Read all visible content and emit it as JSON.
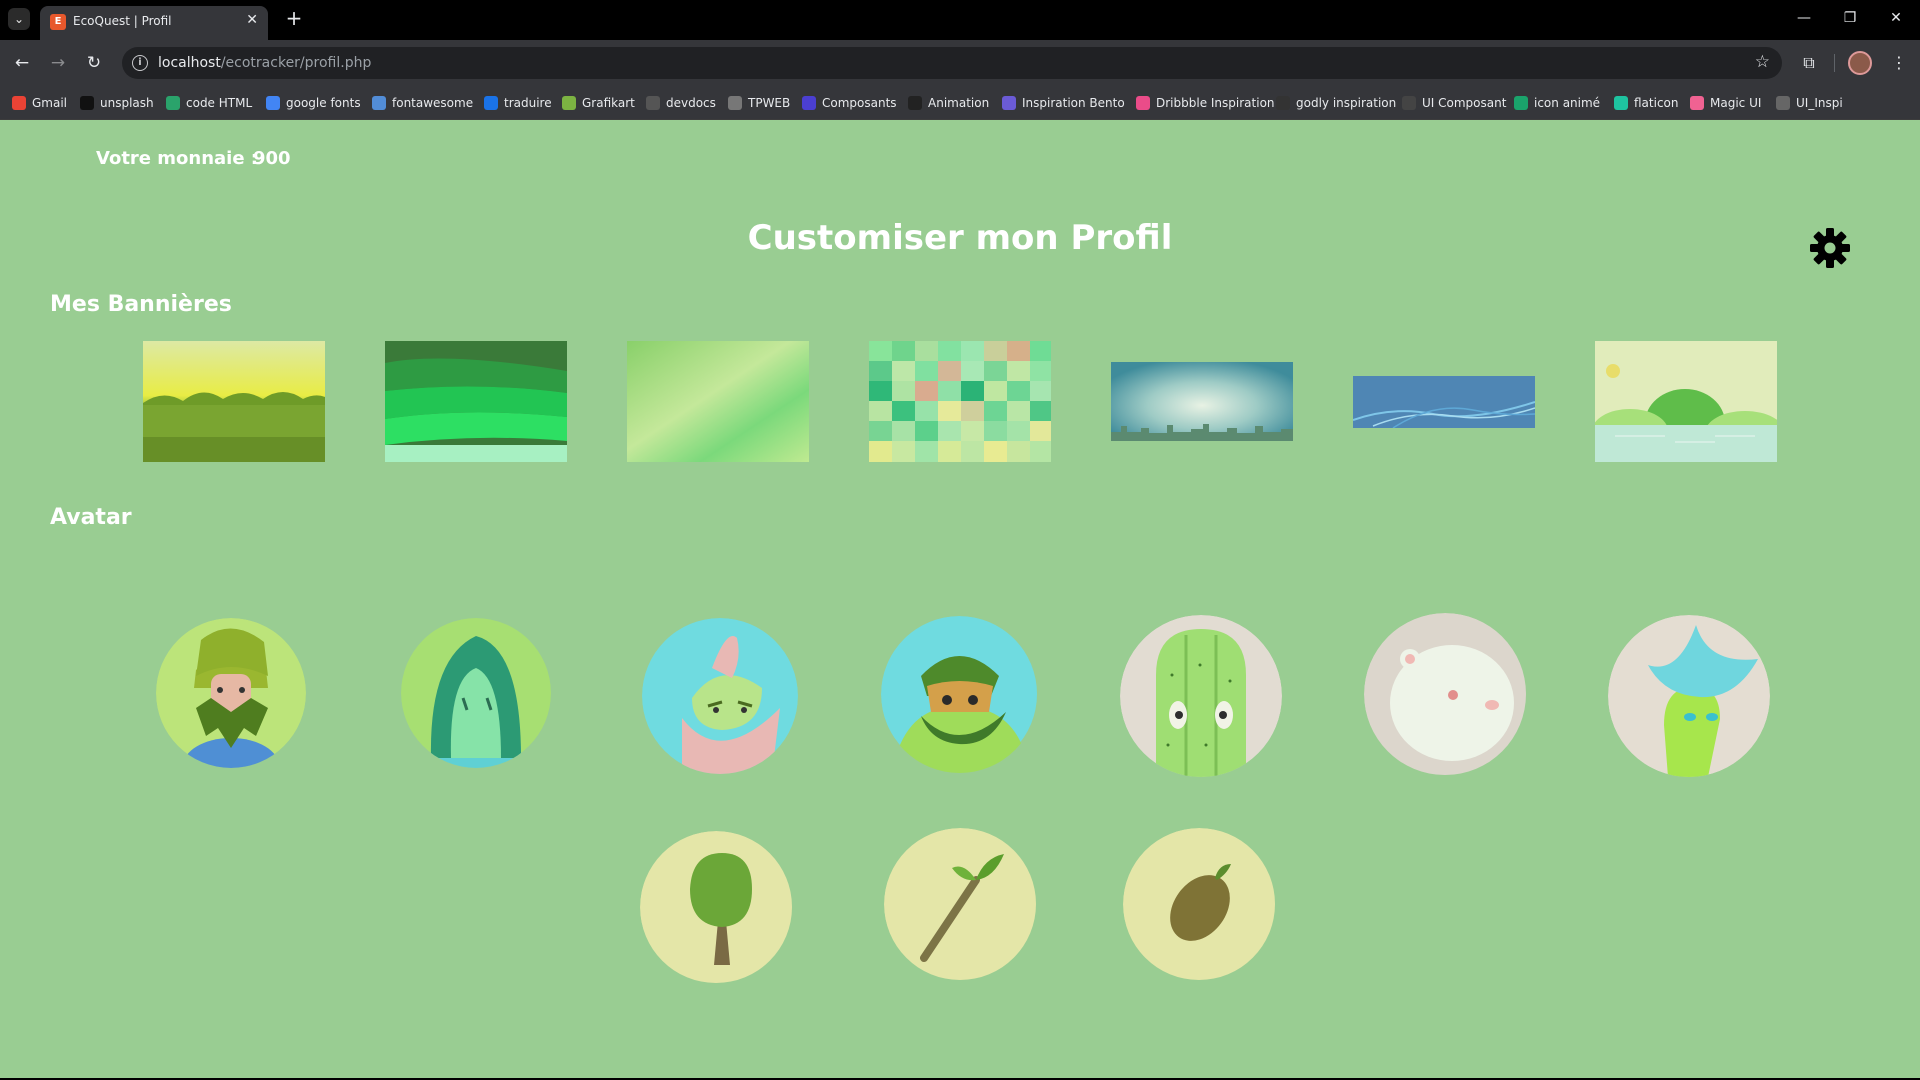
{
  "browser": {
    "tab_title": "EcoQuest | Profil",
    "url_host": "localhost",
    "url_path": "/ecotracker/profil.php",
    "bookmarks": [
      {
        "label": "Gmail",
        "icon": "gmail-icon",
        "color": "#ea4335"
      },
      {
        "label": "unsplash",
        "icon": "unsplash-icon",
        "color": "#111111"
      },
      {
        "label": "code HTML",
        "icon": "w-icon",
        "color": "#2aa36b"
      },
      {
        "label": "google fonts",
        "icon": "google-fonts-icon",
        "color": "#4285f4"
      },
      {
        "label": "fontawesome",
        "icon": "flag-icon",
        "color": "#528dd7"
      },
      {
        "label": "traduire",
        "icon": "translate-icon",
        "color": "#1a73e8"
      },
      {
        "label": "Grafikart",
        "icon": "grafikart-icon",
        "color": "#7cb342"
      },
      {
        "label": "devdocs",
        "icon": "search-doc-icon",
        "color": "#555555"
      },
      {
        "label": "TPWEB",
        "icon": "tpweb-icon",
        "color": "#777777"
      },
      {
        "label": "Composants",
        "icon": "ui-icon",
        "color": "#4b3fd1"
      },
      {
        "label": "Animation",
        "icon": "animation-icon",
        "color": "#222222"
      },
      {
        "label": "Inspiration Bento",
        "icon": "bento-icon",
        "color": "#6b5bd6"
      },
      {
        "label": "Dribbble Inspiration",
        "icon": "dribbble-icon",
        "color": "#ea4c89"
      },
      {
        "label": "godly inspiration",
        "icon": "bolt-icon",
        "color": "#333333"
      },
      {
        "label": "UI Composant",
        "icon": "globe-icon",
        "color": "#444444"
      },
      {
        "label": "icon animé",
        "icon": "crown-icon",
        "color": "#1aa36b"
      },
      {
        "label": "flaticon",
        "icon": "flaticon-icon",
        "color": "#1ec3a0"
      },
      {
        "label": "Magic UI",
        "icon": "magic-icon",
        "color": "#f06292"
      },
      {
        "label": "UI_Inspi",
        "icon": "folder-icon",
        "color": "#666666"
      }
    ]
  },
  "profile": {
    "currency_label": "Votre monnaie :",
    "currency_value": "900",
    "title": "Customiser mon Profil",
    "banners_title": "Mes Bannières",
    "avatars_title": "Avatar"
  },
  "colors": {
    "page_background": "#99cd92",
    "text": "#ffffff"
  },
  "banners": [
    {
      "name": "banner-forest-sunrise"
    },
    {
      "name": "banner-green-waves"
    },
    {
      "name": "banner-green-gradient"
    },
    {
      "name": "banner-green-mosaic"
    },
    {
      "name": "banner-city-skyline"
    },
    {
      "name": "banner-blue-waves"
    },
    {
      "name": "banner-green-hills-lake"
    }
  ],
  "avatars": [
    {
      "name": "avatar-bearded-gnome"
    },
    {
      "name": "avatar-teal-hood"
    },
    {
      "name": "avatar-pink-leaf-creature"
    },
    {
      "name": "avatar-hooded-hunter"
    },
    {
      "name": "avatar-cactus"
    },
    {
      "name": "avatar-polar-bear"
    },
    {
      "name": "avatar-leaf-crest-creature"
    },
    {
      "name": "avatar-tree"
    },
    {
      "name": "avatar-sprout"
    },
    {
      "name": "avatar-seed"
    }
  ]
}
